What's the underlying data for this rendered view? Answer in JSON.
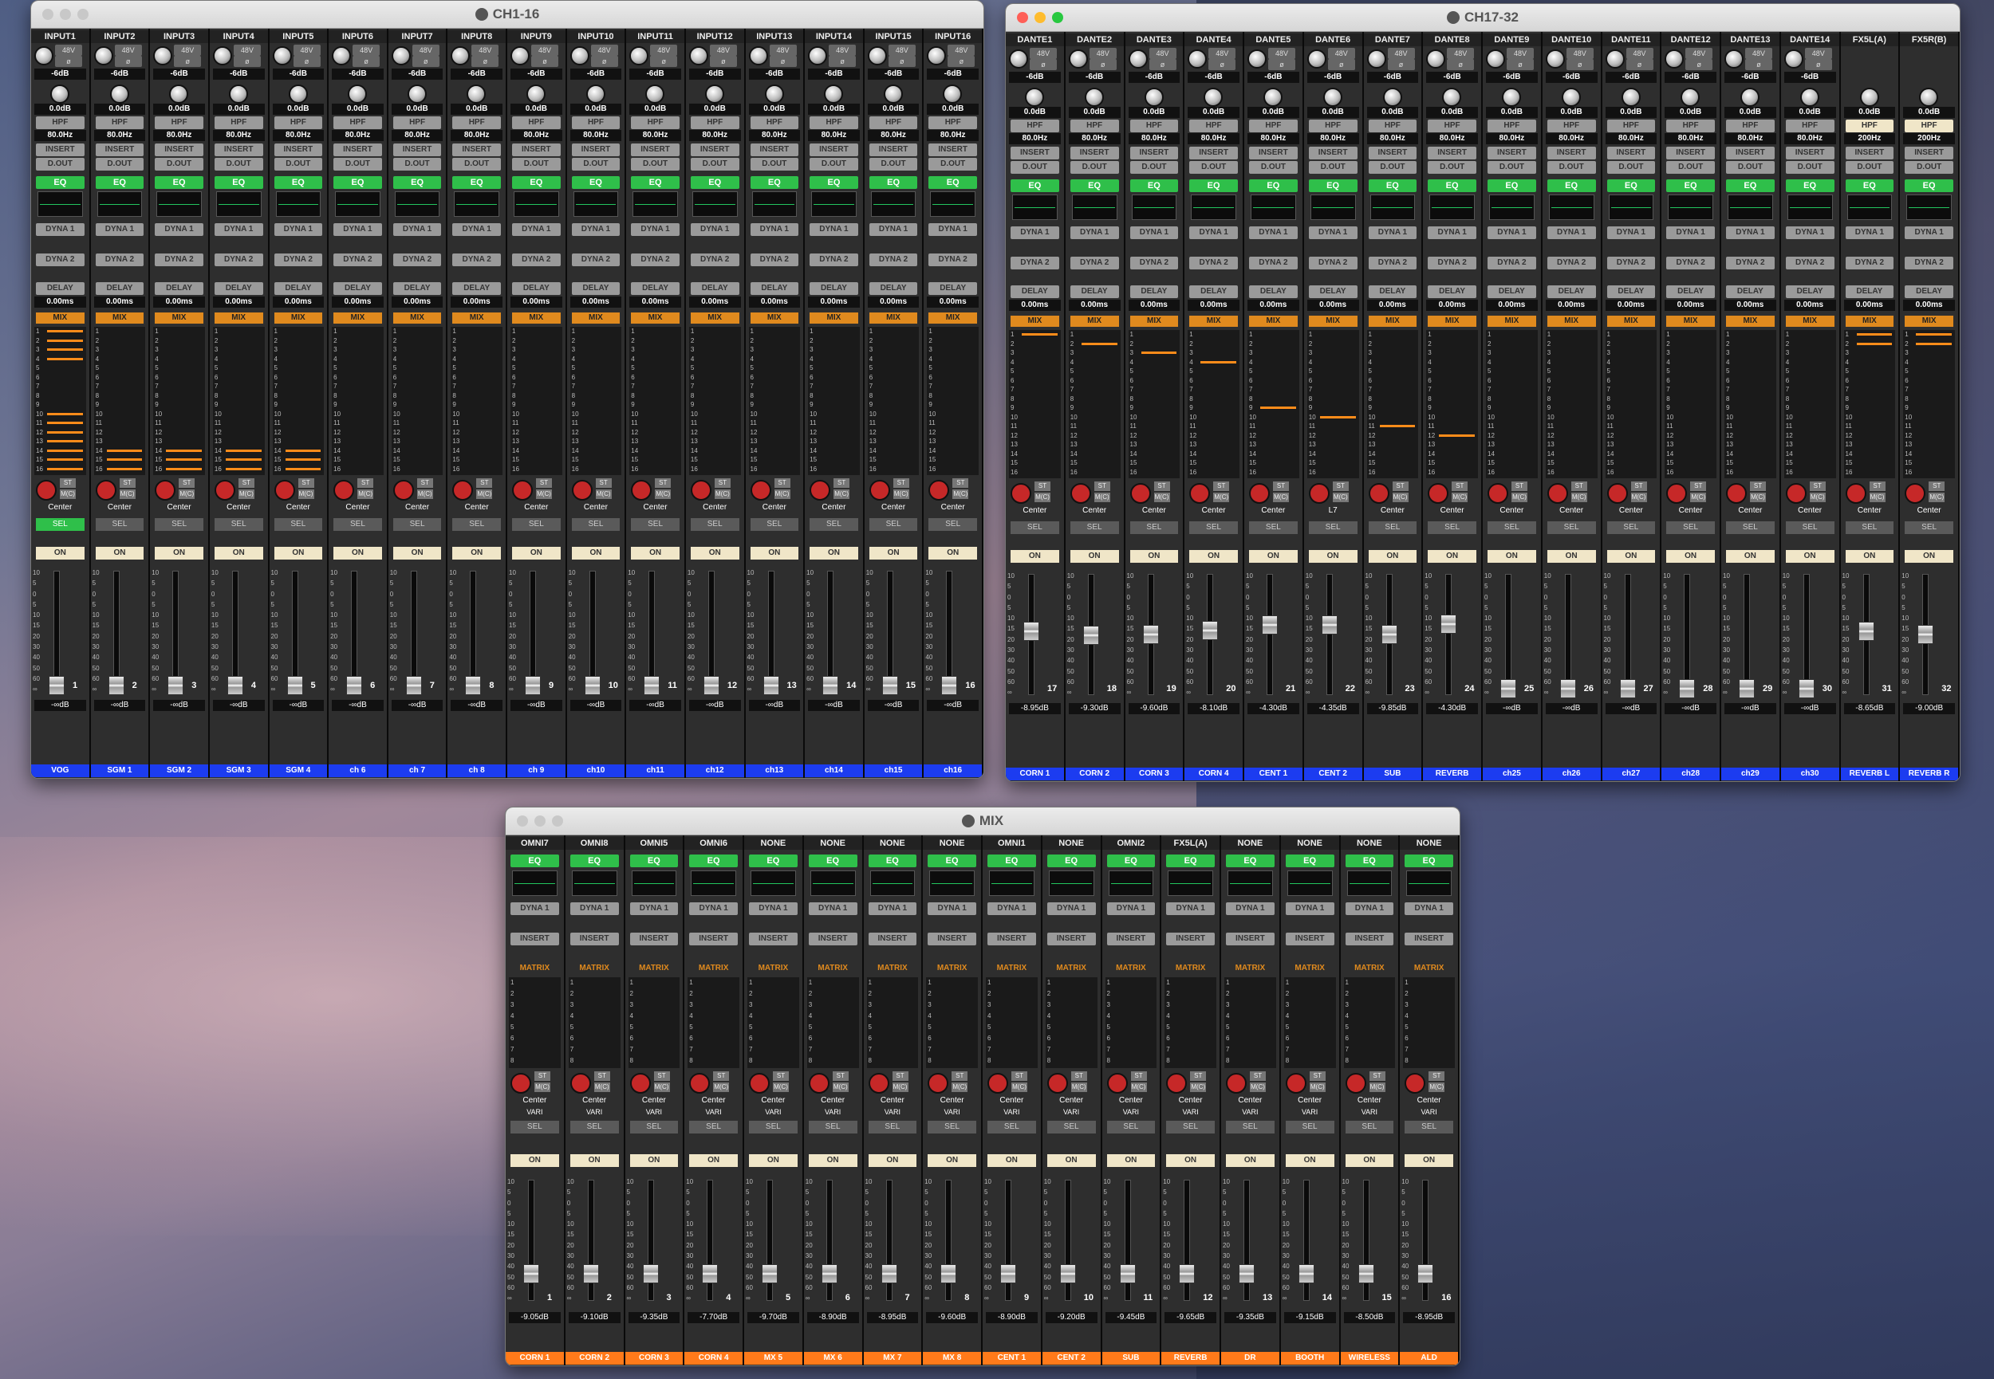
{
  "colors": {
    "eq_green": "#2fbf4a",
    "mix_orange": "#e08a1e",
    "label_blue": "#1c3cf0",
    "label_orange": "#ff7a1a",
    "pan_red": "#c62828"
  },
  "window1": {
    "title": "CH1-16",
    "channels": [
      {
        "name": "INPUT1",
        "gain": "-6dB",
        "trim": "0.0dB",
        "hpf": "HPF",
        "hpf_freq": "80.0Hz",
        "delay": "0.00ms",
        "pan": "Center",
        "sel": "SEL",
        "sel_on": true,
        "on": "ON",
        "level": "-∞dB",
        "number": "1",
        "label": "VOG",
        "sends": [
          1,
          2,
          3,
          4,
          10,
          11,
          12,
          13,
          14,
          15,
          16
        ]
      },
      {
        "name": "INPUT2",
        "gain": "-6dB",
        "trim": "0.0dB",
        "hpf": "HPF",
        "hpf_freq": "80.0Hz",
        "delay": "0.00ms",
        "pan": "Center",
        "sel": "SEL",
        "on": "ON",
        "level": "-∞dB",
        "number": "2",
        "label": "SGM 1",
        "sends": [
          14,
          15,
          16
        ]
      },
      {
        "name": "INPUT3",
        "gain": "-6dB",
        "trim": "0.0dB",
        "hpf": "HPF",
        "hpf_freq": "80.0Hz",
        "delay": "0.00ms",
        "pan": "Center",
        "sel": "SEL",
        "on": "ON",
        "level": "-∞dB",
        "number": "3",
        "label": "SGM 2",
        "sends": [
          14,
          15,
          16
        ]
      },
      {
        "name": "INPUT4",
        "gain": "-6dB",
        "trim": "0.0dB",
        "hpf": "HPF",
        "hpf_freq": "80.0Hz",
        "delay": "0.00ms",
        "pan": "Center",
        "sel": "SEL",
        "on": "ON",
        "level": "-∞dB",
        "number": "4",
        "label": "SGM 3",
        "sends": [
          14,
          15,
          16
        ]
      },
      {
        "name": "INPUT5",
        "gain": "-6dB",
        "trim": "0.0dB",
        "hpf": "HPF",
        "hpf_freq": "80.0Hz",
        "delay": "0.00ms",
        "pan": "Center",
        "sel": "SEL",
        "on": "ON",
        "level": "-∞dB",
        "number": "5",
        "label": "SGM 4",
        "sends": [
          14,
          15,
          16
        ]
      },
      {
        "name": "INPUT6",
        "gain": "-6dB",
        "trim": "0.0dB",
        "hpf": "HPF",
        "hpf_freq": "80.0Hz",
        "delay": "0.00ms",
        "pan": "Center",
        "sel": "SEL",
        "on": "ON",
        "level": "-∞dB",
        "number": "6",
        "label": "ch 6",
        "sends": []
      },
      {
        "name": "INPUT7",
        "gain": "-6dB",
        "trim": "0.0dB",
        "hpf": "HPF",
        "hpf_freq": "80.0Hz",
        "delay": "0.00ms",
        "pan": "Center",
        "sel": "SEL",
        "on": "ON",
        "level": "-∞dB",
        "number": "7",
        "label": "ch 7",
        "sends": []
      },
      {
        "name": "INPUT8",
        "gain": "-6dB",
        "trim": "0.0dB",
        "hpf": "HPF",
        "hpf_freq": "80.0Hz",
        "delay": "0.00ms",
        "pan": "Center",
        "sel": "SEL",
        "on": "ON",
        "level": "-∞dB",
        "number": "8",
        "label": "ch 8",
        "sends": []
      },
      {
        "name": "INPUT9",
        "gain": "-6dB",
        "trim": "0.0dB",
        "hpf": "HPF",
        "hpf_freq": "80.0Hz",
        "delay": "0.00ms",
        "pan": "Center",
        "sel": "SEL",
        "on": "ON",
        "level": "-∞dB",
        "number": "9",
        "label": "ch 9",
        "sends": []
      },
      {
        "name": "INPUT10",
        "gain": "-6dB",
        "trim": "0.0dB",
        "hpf": "HPF",
        "hpf_freq": "80.0Hz",
        "delay": "0.00ms",
        "pan": "Center",
        "sel": "SEL",
        "on": "ON",
        "level": "-∞dB",
        "number": "10",
        "label": "ch10",
        "sends": []
      },
      {
        "name": "INPUT11",
        "gain": "-6dB",
        "trim": "0.0dB",
        "hpf": "HPF",
        "hpf_freq": "80.0Hz",
        "delay": "0.00ms",
        "pan": "Center",
        "sel": "SEL",
        "on": "ON",
        "level": "-∞dB",
        "number": "11",
        "label": "ch11",
        "sends": []
      },
      {
        "name": "INPUT12",
        "gain": "-6dB",
        "trim": "0.0dB",
        "hpf": "HPF",
        "hpf_freq": "80.0Hz",
        "delay": "0.00ms",
        "pan": "Center",
        "sel": "SEL",
        "on": "ON",
        "level": "-∞dB",
        "number": "12",
        "label": "ch12",
        "sends": []
      },
      {
        "name": "INPUT13",
        "gain": "-6dB",
        "trim": "0.0dB",
        "hpf": "HPF",
        "hpf_freq": "80.0Hz",
        "delay": "0.00ms",
        "pan": "Center",
        "sel": "SEL",
        "on": "ON",
        "level": "-∞dB",
        "number": "13",
        "label": "ch13",
        "sends": []
      },
      {
        "name": "INPUT14",
        "gain": "-6dB",
        "trim": "0.0dB",
        "hpf": "HPF",
        "hpf_freq": "80.0Hz",
        "delay": "0.00ms",
        "pan": "Center",
        "sel": "SEL",
        "on": "ON",
        "level": "-∞dB",
        "number": "14",
        "label": "ch14",
        "sends": []
      },
      {
        "name": "INPUT15",
        "gain": "-6dB",
        "trim": "0.0dB",
        "hpf": "HPF",
        "hpf_freq": "80.0Hz",
        "delay": "0.00ms",
        "pan": "Center",
        "sel": "SEL",
        "on": "ON",
        "level": "-∞dB",
        "number": "15",
        "label": "ch15",
        "sends": []
      },
      {
        "name": "INPUT16",
        "gain": "-6dB",
        "trim": "0.0dB",
        "hpf": "HPF",
        "hpf_freq": "80.0Hz",
        "delay": "0.00ms",
        "pan": "Center",
        "sel": "SEL",
        "on": "ON",
        "level": "-∞dB",
        "number": "16",
        "label": "ch16",
        "sends": []
      }
    ]
  },
  "window2": {
    "title": "CH17-32",
    "channels": [
      {
        "name": "DANTE1",
        "gain": "-6dB",
        "trim": "0.0dB",
        "hpf": "HPF",
        "hpf_freq": "80.0Hz",
        "delay": "0.00ms",
        "pan": "Center",
        "sel": "SEL",
        "on": "ON",
        "level": "-8.95dB",
        "number": "17",
        "label": "CORN 1",
        "sends": [
          1
        ]
      },
      {
        "name": "DANTE2",
        "gain": "-6dB",
        "trim": "0.0dB",
        "hpf": "HPF",
        "hpf_freq": "80.0Hz",
        "delay": "0.00ms",
        "pan": "Center",
        "sel": "SEL",
        "on": "ON",
        "level": "-9.30dB",
        "number": "18",
        "label": "CORN 2",
        "sends": [
          2
        ]
      },
      {
        "name": "DANTE3",
        "gain": "-6dB",
        "trim": "0.0dB",
        "hpf": "HPF",
        "hpf_freq": "80.0Hz",
        "delay": "0.00ms",
        "pan": "Center",
        "sel": "SEL",
        "on": "ON",
        "level": "-9.60dB",
        "number": "19",
        "label": "CORN 3",
        "sends": [
          3
        ]
      },
      {
        "name": "DANTE4",
        "gain": "-6dB",
        "trim": "0.0dB",
        "hpf": "HPF",
        "hpf_freq": "80.0Hz",
        "delay": "0.00ms",
        "pan": "Center",
        "sel": "SEL",
        "on": "ON",
        "level": "-8.10dB",
        "number": "20",
        "label": "CORN 4",
        "sends": [
          4
        ]
      },
      {
        "name": "DANTE5",
        "gain": "-6dB",
        "trim": "0.0dB",
        "hpf": "HPF",
        "hpf_freq": "80.0Hz",
        "delay": "0.00ms",
        "pan": "Center",
        "sel": "SEL",
        "on": "ON",
        "level": "-4.30dB",
        "number": "21",
        "label": "CENT 1",
        "sends": [
          9
        ]
      },
      {
        "name": "DANTE6",
        "gain": "-6dB",
        "trim": "0.0dB",
        "hpf": "HPF",
        "hpf_freq": "80.0Hz",
        "delay": "0.00ms",
        "pan": "L7",
        "sel": "SEL",
        "on": "ON",
        "level": "-4.35dB",
        "number": "22",
        "label": "CENT 2",
        "sends": [
          10
        ]
      },
      {
        "name": "DANTE7",
        "gain": "-6dB",
        "trim": "0.0dB",
        "hpf": "HPF",
        "hpf_freq": "80.0Hz",
        "delay": "0.00ms",
        "pan": "Center",
        "sel": "SEL",
        "on": "ON",
        "level": "-9.85dB",
        "number": "23",
        "label": "SUB",
        "sends": [
          11
        ]
      },
      {
        "name": "DANTE8",
        "gain": "-6dB",
        "trim": "0.0dB",
        "hpf": "HPF",
        "hpf_freq": "80.0Hz",
        "delay": "0.00ms",
        "pan": "Center",
        "sel": "SEL",
        "on": "ON",
        "level": "-4.30dB",
        "number": "24",
        "label": "REVERB",
        "sends": [
          12
        ]
      },
      {
        "name": "DANTE9",
        "gain": "-6dB",
        "trim": "0.0dB",
        "hpf": "HPF",
        "hpf_freq": "80.0Hz",
        "delay": "0.00ms",
        "pan": "Center",
        "sel": "SEL",
        "on": "ON",
        "level": "-∞dB",
        "number": "25",
        "label": "ch25",
        "sends": []
      },
      {
        "name": "DANTE10",
        "gain": "-6dB",
        "trim": "0.0dB",
        "hpf": "HPF",
        "hpf_freq": "80.0Hz",
        "delay": "0.00ms",
        "pan": "Center",
        "sel": "SEL",
        "on": "ON",
        "level": "-∞dB",
        "number": "26",
        "label": "ch26",
        "sends": []
      },
      {
        "name": "DANTE11",
        "gain": "-6dB",
        "trim": "0.0dB",
        "hpf": "HPF",
        "hpf_freq": "80.0Hz",
        "delay": "0.00ms",
        "pan": "Center",
        "sel": "SEL",
        "on": "ON",
        "level": "-∞dB",
        "number": "27",
        "label": "ch27",
        "sends": []
      },
      {
        "name": "DANTE12",
        "gain": "-6dB",
        "trim": "0.0dB",
        "hpf": "HPF",
        "hpf_freq": "80.0Hz",
        "delay": "0.00ms",
        "pan": "Center",
        "sel": "SEL",
        "on": "ON",
        "level": "-∞dB",
        "number": "28",
        "label": "ch28",
        "sends": []
      },
      {
        "name": "DANTE13",
        "gain": "-6dB",
        "trim": "0.0dB",
        "hpf": "HPF",
        "hpf_freq": "80.0Hz",
        "delay": "0.00ms",
        "pan": "Center",
        "sel": "SEL",
        "on": "ON",
        "level": "-∞dB",
        "number": "29",
        "label": "ch29",
        "sends": []
      },
      {
        "name": "DANTE14",
        "gain": "-6dB",
        "trim": "0.0dB",
        "hpf": "HPF",
        "hpf_freq": "80.0Hz",
        "delay": "0.00ms",
        "pan": "Center",
        "sel": "SEL",
        "on": "ON",
        "level": "-∞dB",
        "number": "30",
        "label": "ch30",
        "sends": []
      },
      {
        "name": "FX5L(A)",
        "gain": "",
        "trim": "0.0dB",
        "hpf": "HPF",
        "hpf_freq": "200Hz",
        "hpf_on": true,
        "delay": "0.00ms",
        "pan": "Center",
        "sel": "SEL",
        "on": "ON",
        "level": "-8.65dB",
        "number": "31",
        "label": "REVERB L",
        "sends": [
          1,
          2
        ]
      },
      {
        "name": "FX5R(B)",
        "gain": "",
        "trim": "0.0dB",
        "hpf": "HPF",
        "hpf_freq": "200Hz",
        "hpf_on": true,
        "delay": "0.00ms",
        "pan": "Center",
        "sel": "SEL",
        "on": "ON",
        "level": "-9.00dB",
        "number": "32",
        "label": "REVERB R",
        "sends": [
          1,
          2
        ]
      }
    ]
  },
  "window3": {
    "title": "MIX",
    "channels": [
      {
        "name": "OMNI7",
        "pan": "Center",
        "vari": "VARI",
        "sel": "SEL",
        "on": "ON",
        "level": "-9.05dB",
        "number": "1",
        "label": "CORN 1"
      },
      {
        "name": "OMNI8",
        "pan": "Center",
        "vari": "VARI",
        "sel": "SEL",
        "on": "ON",
        "level": "-9.10dB",
        "number": "2",
        "label": "CORN 2"
      },
      {
        "name": "OMNI5",
        "pan": "Center",
        "vari": "VARI",
        "sel": "SEL",
        "on": "ON",
        "level": "-9.35dB",
        "number": "3",
        "label": "CORN 3"
      },
      {
        "name": "OMNI6",
        "pan": "Center",
        "vari": "VARI",
        "sel": "SEL",
        "on": "ON",
        "level": "-7.70dB",
        "number": "4",
        "label": "CORN 4"
      },
      {
        "name": "NONE",
        "pan": "Center",
        "vari": "VARI",
        "sel": "SEL",
        "on": "ON",
        "level": "-9.70dB",
        "number": "5",
        "label": "MX 5"
      },
      {
        "name": "NONE",
        "pan": "Center",
        "vari": "VARI",
        "sel": "SEL",
        "on": "ON",
        "level": "-8.90dB",
        "number": "6",
        "label": "MX 6"
      },
      {
        "name": "NONE",
        "pan": "Center",
        "vari": "VARI",
        "sel": "SEL",
        "on": "ON",
        "level": "-8.95dB",
        "number": "7",
        "label": "MX 7"
      },
      {
        "name": "NONE",
        "pan": "Center",
        "vari": "VARI",
        "sel": "SEL",
        "on": "ON",
        "level": "-9.60dB",
        "number": "8",
        "label": "MX 8"
      },
      {
        "name": "OMNI1",
        "pan": "Center",
        "vari": "VARI",
        "sel": "SEL",
        "on": "ON",
        "level": "-8.90dB",
        "number": "9",
        "label": "CENT 1"
      },
      {
        "name": "NONE",
        "pan": "Center",
        "vari": "VARI",
        "sel": "SEL",
        "on": "ON",
        "level": "-9.20dB",
        "number": "10",
        "label": "CENT 2"
      },
      {
        "name": "OMNI2",
        "pan": "Center",
        "vari": "VARI",
        "sel": "SEL",
        "on": "ON",
        "level": "-9.45dB",
        "number": "11",
        "label": "SUB"
      },
      {
        "name": "FX5L(A)",
        "pan": "Center",
        "vari": "VARI",
        "sel": "SEL",
        "on": "ON",
        "level": "-9.65dB",
        "number": "12",
        "label": "REVERB"
      },
      {
        "name": "NONE",
        "pan": "Center",
        "vari": "VARI",
        "sel": "SEL",
        "on": "ON",
        "level": "-9.35dB",
        "number": "13",
        "label": "DR"
      },
      {
        "name": "NONE",
        "pan": "Center",
        "vari": "VARI",
        "sel": "SEL",
        "on": "ON",
        "level": "-9.15dB",
        "number": "14",
        "label": "BOOTH"
      },
      {
        "name": "NONE",
        "pan": "Center",
        "vari": "VARI",
        "sel": "SEL",
        "on": "ON",
        "level": "-8.50dB",
        "number": "15",
        "label": "WIRELESS"
      },
      {
        "name": "NONE",
        "pan": "Center",
        "vari": "VARI",
        "sel": "SEL",
        "on": "ON",
        "level": "-8.95dB",
        "number": "16",
        "label": "ALD"
      }
    ]
  },
  "common": {
    "phantom": "48V",
    "phase": "ø",
    "insert": "INSERT",
    "dout": "D.OUT",
    "eq": "EQ",
    "dyna1": "DYNA 1",
    "dyna2": "DYNA 2",
    "delay": "DELAY",
    "mix": "MIX",
    "matrix": "MATRIX",
    "st": "ST",
    "mc": "M(C)",
    "scale": [
      "10",
      "5",
      "0",
      "5",
      "10",
      "15",
      "20",
      "30",
      "40",
      "50",
      "60",
      "∞"
    ]
  }
}
